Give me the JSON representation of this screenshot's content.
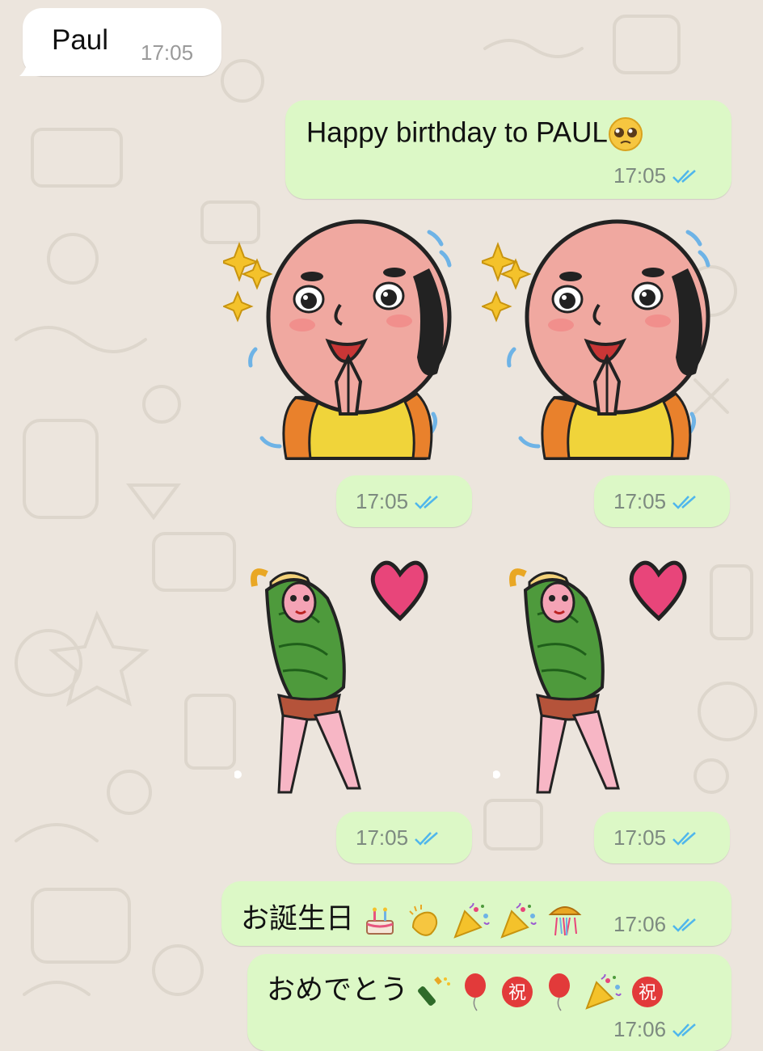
{
  "chat": {
    "colors": {
      "background": "#ECE5DD",
      "incoming_bubble": "#FFFFFF",
      "outgoing_bubble": "#DCF8C6",
      "read_ticks": "#4FB6EC",
      "timestamp": "#7D8A80"
    },
    "messages": [
      {
        "id": "m1",
        "direction": "incoming",
        "text": "Paul",
        "time": "17:05"
      },
      {
        "id": "m2",
        "direction": "outgoing",
        "text": "Happy birthday to PAUL",
        "emoji_suffix": "pleading-face-emoji",
        "time": "17:05",
        "status": "read"
      },
      {
        "id": "m3",
        "direction": "outgoing",
        "type": "sticker",
        "sticker": "bald-man-pleading-sticker",
        "time": "17:05",
        "status": "read"
      },
      {
        "id": "m4",
        "direction": "outgoing",
        "type": "sticker",
        "sticker": "bald-man-pleading-sticker",
        "time": "17:05",
        "status": "read"
      },
      {
        "id": "m5",
        "direction": "outgoing",
        "type": "sticker",
        "sticker": "watermelon-girl-heart-sticker",
        "time": "17:05",
        "status": "read"
      },
      {
        "id": "m6",
        "direction": "outgoing",
        "type": "sticker",
        "sticker": "watermelon-girl-heart-sticker",
        "time": "17:05",
        "status": "read"
      },
      {
        "id": "m7",
        "direction": "outgoing",
        "text": "お誕生日",
        "emojis": [
          "birthday-cake-emoji",
          "clapping-hands-emoji",
          "party-popper-emoji",
          "party-popper-emoji",
          "confetti-ball-emoji"
        ],
        "time": "17:06",
        "status": "read"
      },
      {
        "id": "m8",
        "direction": "outgoing",
        "text": "おめでとう",
        "emojis": [
          "champagne-emoji",
          "balloon-emoji",
          "congratulations-kanji-emoji",
          "balloon-emoji",
          "party-popper-emoji",
          "congratulations-kanji-emoji"
        ],
        "time": "17:06",
        "status": "read"
      }
    ]
  }
}
